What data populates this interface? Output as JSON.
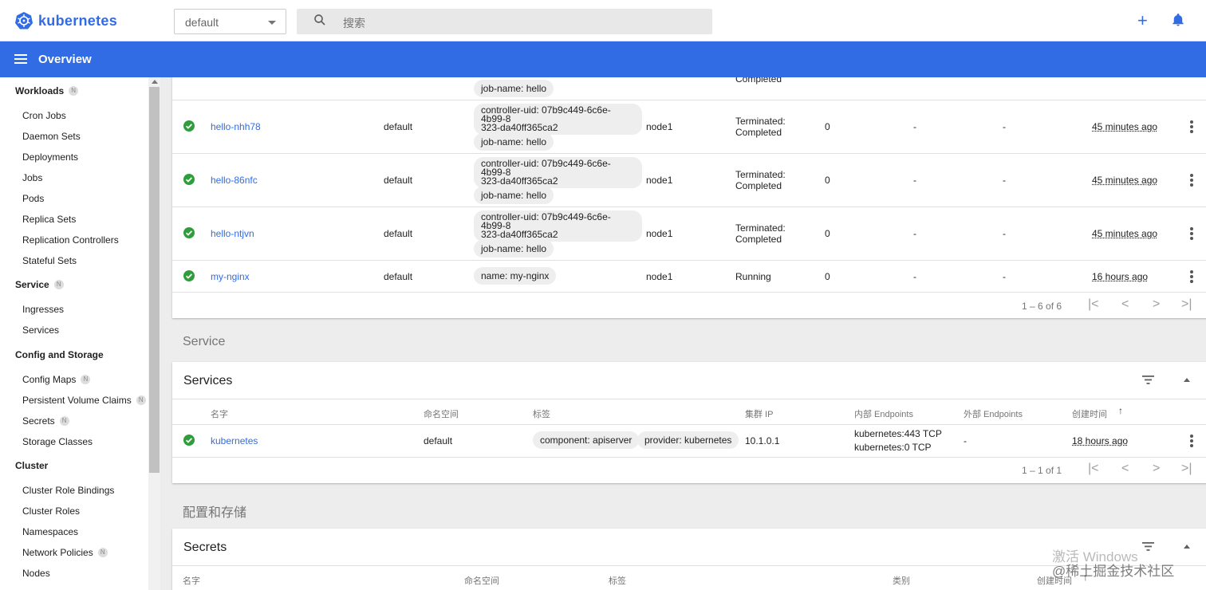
{
  "app": {
    "brand": "kubernetes",
    "accent": "#326ce5",
    "ok_color": "#2e9e3b"
  },
  "topbar": {
    "namespace": "default",
    "search_placeholder": "搜索",
    "plus_icon": "plus-icon",
    "bell_icon": "bell-icon"
  },
  "titlebar": {
    "title": "Overview"
  },
  "sidebar": {
    "workloads": {
      "label": "Workloads",
      "badge": "N",
      "items": [
        "Cron Jobs",
        "Daemon Sets",
        "Deployments",
        "Jobs",
        "Pods",
        "Replica Sets",
        "Replication Controllers",
        "Stateful Sets"
      ]
    },
    "service": {
      "label": "Service",
      "badge": "N",
      "items": [
        "Ingresses",
        "Services"
      ]
    },
    "config": {
      "label": "Config and Storage",
      "items": [
        "Config Maps",
        "Persistent Volume Claims",
        "Secrets",
        "Storage Classes"
      ],
      "badges": [
        "N",
        "N",
        "N",
        ""
      ]
    },
    "cluster": {
      "label": "Cluster",
      "items": [
        "Cluster Role Bindings",
        "Cluster Roles",
        "Namespaces",
        "Network Policies",
        "Nodes"
      ],
      "badges": [
        "",
        "",
        "",
        "N",
        ""
      ]
    }
  },
  "pods": {
    "partial_row": {
      "label": "job-name: hello",
      "status": "Completed"
    },
    "rows": [
      {
        "name": "hello-nhh78",
        "namespace": "default",
        "label1": "controller-uid: 07b9c449-6c6e-4b99-8323-da40ff365ca2",
        "label1a": "controller-uid: 07b9c449-6c6e-4b99-8",
        "label1b": "323-da40ff365ca2",
        "label2": "job-name: hello",
        "node": "node1",
        "status1": "Terminated:",
        "status2": "Completed",
        "restarts": "0",
        "cpu": "-",
        "mem": "-",
        "age": "45 minutes ago"
      },
      {
        "name": "hello-86nfc",
        "namespace": "default",
        "label1a": "controller-uid: 07b9c449-6c6e-4b99-8",
        "label1b": "323-da40ff365ca2",
        "label2": "job-name: hello",
        "node": "node1",
        "status1": "Terminated:",
        "status2": "Completed",
        "restarts": "0",
        "cpu": "-",
        "mem": "-",
        "age": "45 minutes ago"
      },
      {
        "name": "hello-ntjvn",
        "namespace": "default",
        "label1a": "controller-uid: 07b9c449-6c6e-4b99-8",
        "label1b": "323-da40ff365ca2",
        "label2": "job-name: hello",
        "node": "node1",
        "status1": "Terminated:",
        "status2": "Completed",
        "restarts": "0",
        "cpu": "-",
        "mem": "-",
        "age": "45 minutes ago"
      },
      {
        "name": "my-nginx",
        "namespace": "default",
        "label1a": "name: my-nginx",
        "node": "node1",
        "status1": "Running",
        "restarts": "0",
        "cpu": "-",
        "mem": "-",
        "age": "16 hours ago"
      }
    ],
    "pagination": "1 – 6 of 6"
  },
  "service_section": {
    "heading": "Service",
    "card_title": "Services",
    "headers": {
      "name": "名字",
      "namespace": "命名空间",
      "labels": "标签",
      "cluster_ip": "集群 IP",
      "internal": "内部 Endpoints",
      "external": "外部 Endpoints",
      "created": "创建时间"
    },
    "rows": [
      {
        "name": "kubernetes",
        "namespace": "default",
        "label1": "component: apiserver",
        "label2": "provider: kubernetes",
        "cluster_ip": "10.1.0.1",
        "internal1": "kubernetes:443 TCP",
        "internal2": "kubernetes:0 TCP",
        "external": "-",
        "age": "18 hours ago"
      }
    ],
    "pagination": "1 – 1 of 1"
  },
  "config_section": {
    "heading": "配置和存储",
    "card_title": "Secrets",
    "headers": {
      "name": "名字",
      "namespace": "命名空间",
      "labels": "标签",
      "type": "类别",
      "created": "创建时间"
    }
  },
  "overlay": {
    "line1": "激活 Windows",
    "line2": "@稀土掘金技术社区"
  }
}
